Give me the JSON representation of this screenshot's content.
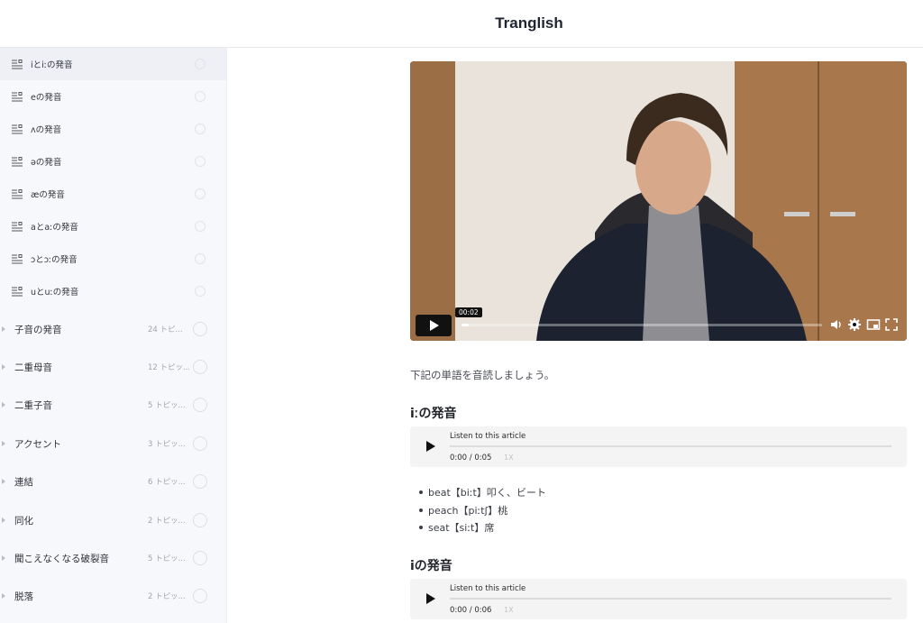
{
  "app": {
    "title": "Tranglish"
  },
  "sidebar": {
    "lessons": [
      {
        "label": "iとiːの発音",
        "icon": "text-lines-icon",
        "active": true
      },
      {
        "label": "eの発音",
        "icon": "text-lines-icon"
      },
      {
        "label": "ʌの発音",
        "icon": "text-lines-icon"
      },
      {
        "label": "əの発音",
        "icon": "text-lines-icon"
      },
      {
        "label": "æの発音",
        "icon": "text-lines-icon"
      },
      {
        "label": "aとaːの発音",
        "icon": "text-lines-icon"
      },
      {
        "label": "ɔとɔːの発音",
        "icon": "text-lines-icon"
      },
      {
        "label": "uとuːの発音",
        "icon": "text-lines-icon"
      }
    ],
    "sections": [
      {
        "label": "子音の発音",
        "count": "24 トピ..."
      },
      {
        "label": "二重母音",
        "count": "12 トピッ..."
      },
      {
        "label": "二重子音",
        "count": "5 トピッ..."
      },
      {
        "label": "アクセント",
        "count": "3 トピッ..."
      },
      {
        "label": "連結",
        "count": "6 トピッ..."
      },
      {
        "label": "同化",
        "count": "2 トピッ..."
      },
      {
        "label": "聞こえなくなる破裂音",
        "count": "5 トピッ..."
      },
      {
        "label": "脱落",
        "count": "2 トピッ..."
      }
    ]
  },
  "video": {
    "tooltip_time": "00:02",
    "progress": 0.02,
    "controls": [
      "volume-icon",
      "settings-gear-icon",
      "picture-in-picture-icon",
      "fullscreen-icon"
    ]
  },
  "content": {
    "intro": "下記の単語を音読しましょう。",
    "sections": [
      {
        "heading": "iːの発音",
        "audio": {
          "title": "Listen to this article",
          "time": "0:00 / 0:05",
          "speed": "1X"
        },
        "words": [
          "beat【biːt】叩く、ビート",
          "peach【piːtʃ】桃",
          "seat【siːt】席"
        ]
      },
      {
        "heading": "iの発音",
        "audio": {
          "title": "Listen to this article",
          "time": "0:00 / 0:06",
          "speed": "1X"
        }
      }
    ]
  },
  "colors": {
    "sidebar_bg": "#f7f8fb",
    "audio_bg": "#f4f4f5",
    "accent": "#111111"
  }
}
